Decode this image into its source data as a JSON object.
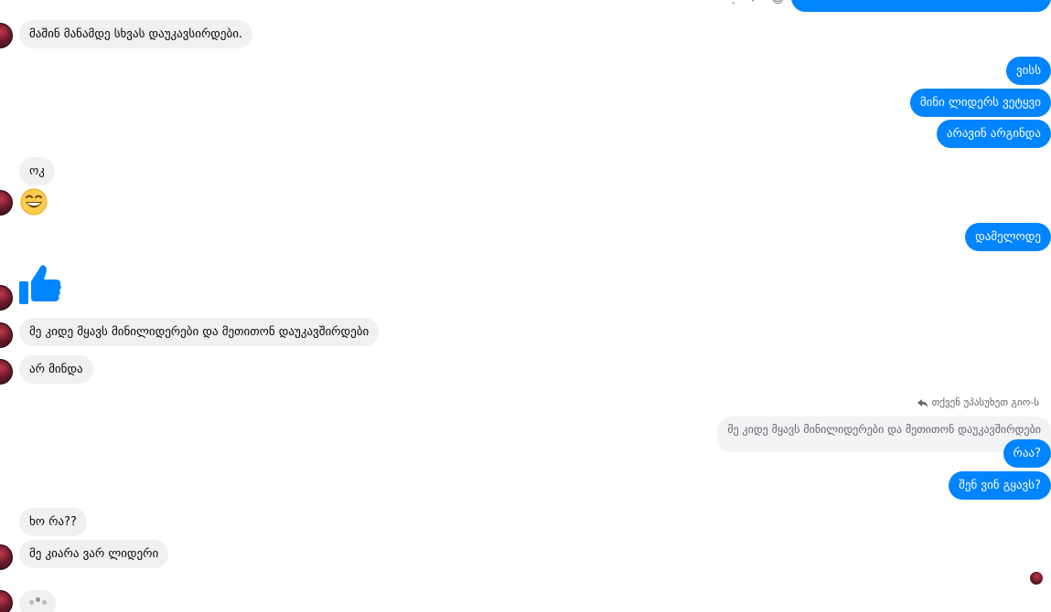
{
  "top_partial_text": "",
  "messages_incoming": [
    {
      "id": "m1",
      "text": "მაშინ მანამდე სხვას დაუკავსირდები."
    },
    {
      "id": "m2",
      "text": "ოკ"
    },
    {
      "id": "m3",
      "text": "მე კიდე მყავს მინილიდერები და მეთითონ დაუკავშირდები"
    },
    {
      "id": "m4",
      "text": "არ მინდა"
    },
    {
      "id": "m5",
      "text": "ხო რა??"
    },
    {
      "id": "m6",
      "text": "მე კიარა ვარ ლიდერი"
    }
  ],
  "messages_outgoing": [
    {
      "id": "o1",
      "text": "ვისს"
    },
    {
      "id": "o2",
      "text": "მინი ლიდერს ვეტყვი"
    },
    {
      "id": "o3",
      "text": "არავინ არგინდა"
    },
    {
      "id": "o4",
      "text": "დამელოდე"
    },
    {
      "id": "o5",
      "text": "რაა?"
    },
    {
      "id": "o6",
      "text": "შენ ვინ გყავს?"
    }
  ],
  "reply": {
    "label": "თქვენ უპასუხეთ გიო-ს",
    "quoted_text": "მე კიდე მყავს მინილიდერები და მეთითონ დაუკავშირდები"
  },
  "colors": {
    "outgoing_bubble": "#0084ff",
    "incoming_bubble": "#f0f0f0",
    "like_icon": "#0084ff"
  },
  "icons": {
    "grin_emoji": "grinning-face-with-smiling-eyes",
    "like": "thumbs-up",
    "reply": "reply-arrow"
  }
}
